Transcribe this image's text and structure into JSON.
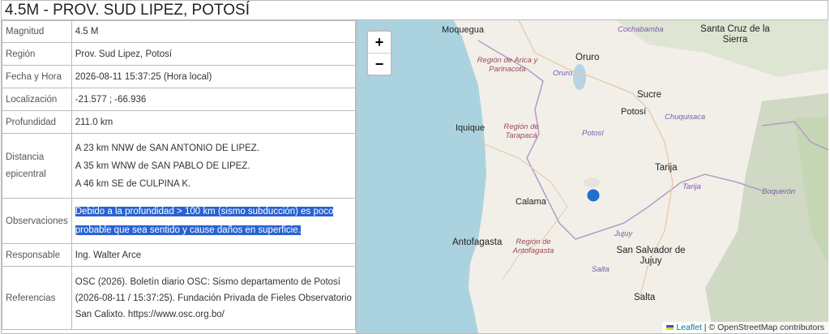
{
  "title": "4.5M - PROV. SUD LIPEZ, POTOSÍ",
  "rows": {
    "magnitud": {
      "label": "Magnitud",
      "value": "4.5 M"
    },
    "region": {
      "label": "Región",
      "value": "Prov. Sud Lipez, Potosí"
    },
    "fecha": {
      "label": "Fecha y Hora",
      "value": "2026-08-11 15:37:25 (Hora local)"
    },
    "localizacion": {
      "label": "Localización",
      "value": "-21.577 ; -66.936"
    },
    "profundidad": {
      "label": "Profundidad",
      "value": "211.0 km"
    },
    "distancia": {
      "label": "Distancia epicentral",
      "lines": [
        "A 23 km NNW de SAN ANTONIO DE LIPEZ.",
        "A 35 km WNW de SAN PABLO DE LIPEZ.",
        "A 46 km SE de CULPINA K."
      ]
    },
    "observaciones": {
      "label": "Observaciones",
      "value": "Debido a la profundidad > 100 km (sismo subducción) es poco probable que sea sentido y cause daños en superficie."
    },
    "responsable": {
      "label": "Responsable",
      "value": "Ing. Walter Arce"
    },
    "referencias": {
      "label": "Referencias",
      "value": "OSC (2026). Boletín diario OSC: Sismo departamento de Potosí (2026-08-11 / 15:37:25). Fundación Privada de Fieles Observatorio San Calixto. https://www.osc.org.bo/"
    }
  },
  "map": {
    "zoom_in": "+",
    "zoom_out": "−",
    "attribution_leaflet": "Leaflet",
    "attribution_sep": " | © ",
    "attribution_osm": "OpenStreetMap contributors",
    "labels": {
      "cochabamba": "Cochabamba",
      "santacruz": "Santa Cruz de la Sierra",
      "moquegua": "Moquegua",
      "arica": "Región de Arica y Parinacota",
      "oruro_city": "Oruro",
      "oruro_dep": "Oruro",
      "sucre": "Sucre",
      "potosi_city": "Potosí",
      "chuquisaca": "Chuquisaca",
      "iquique": "Iquique",
      "tarapaca": "Región de Tarapacá",
      "potosi_dep": "Potosí",
      "tarija_city": "Tarija",
      "tarija_dep": "Tarija",
      "boqueron": "Boquerón",
      "calama": "Calama",
      "antofagasta_city": "Antofagasta",
      "antofagasta_reg": "Región de Antofagasta",
      "jujuy_prov": "Jujuy",
      "sansalvador": "San Salvador de Jujuy",
      "salta_prov": "Salta",
      "salta_city": "Salta"
    }
  },
  "colors": {
    "highlight": "#2a62d1",
    "ocean": "#aad3df",
    "land": "#f2efe9",
    "marker": "#1f6fd0"
  }
}
